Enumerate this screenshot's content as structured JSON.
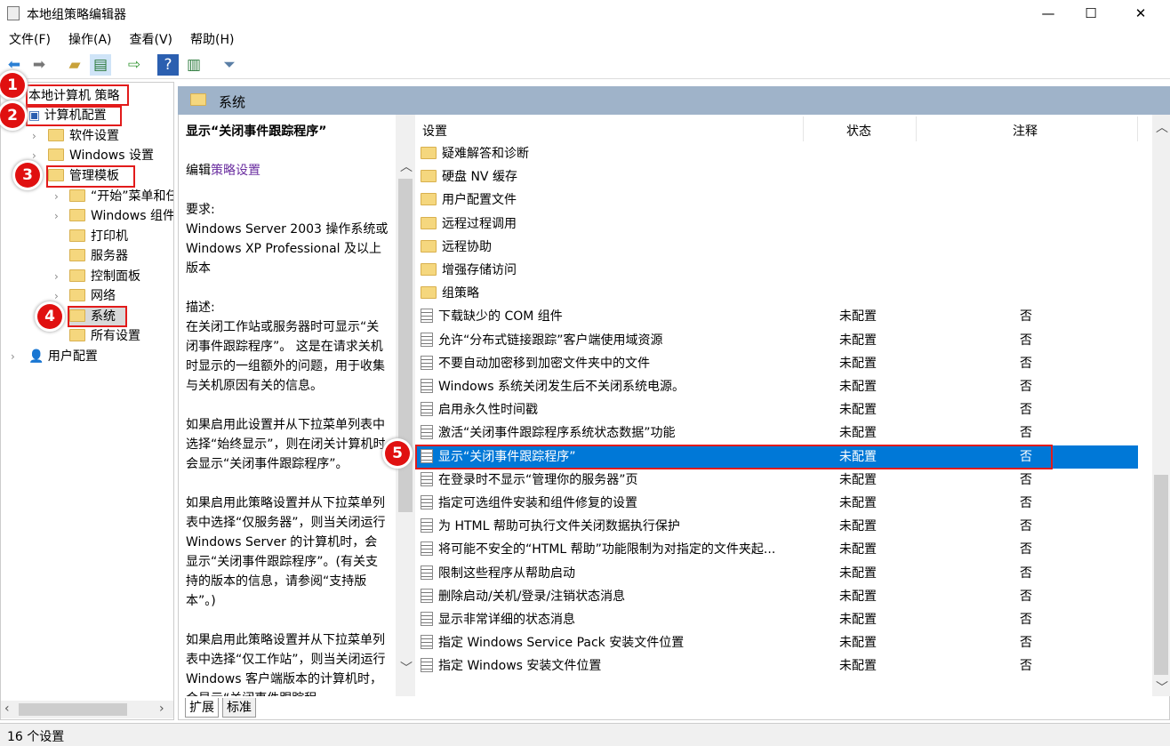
{
  "window": {
    "title": "本地组策略编辑器",
    "min": "—",
    "max": "☐",
    "close": "✕"
  },
  "menu": [
    "文件(F)",
    "操作(A)",
    "查看(V)",
    "帮助(H)"
  ],
  "tree": {
    "root": "本地计算机 策略",
    "computer": "计算机配置",
    "software": "软件设置",
    "windows": "Windows 设置",
    "admin": "管理模板",
    "start": "“开始”菜单和任务栏",
    "wincomp": "Windows 组件",
    "printer": "打印机",
    "server": "服务器",
    "control": "控制面板",
    "network": "网络",
    "system": "系统",
    "all": "所有设置",
    "user": "用户配置"
  },
  "badges": [
    "1",
    "2",
    "3",
    "4",
    "5"
  ],
  "header": {
    "title": "系统"
  },
  "desc": {
    "title": "显示“关闭事件跟踪程序”",
    "edit_prefix": "编辑",
    "edit_link": "策略设置",
    "req_label": "要求:",
    "req": "Windows Server 2003 操作系统或 Windows XP Professional 及以上版本",
    "desc_label": "描述:",
    "p1": "在关闭工作站或服务器时可显示“关闭事件跟踪程序”。 这是在请求关机时显示的一组额外的问题，用于收集与关机原因有关的信息。",
    "p2": "如果启用此设置并从下拉菜单列表中选择“始终显示”，则在闭关计算机时会显示“关闭事件跟踪程序”。",
    "p3": "如果启用此策略设置并从下拉菜单列表中选择“仅服务器”，则当关闭运行 Windows Server 的计算机时，会显示“关闭事件跟踪程序”。(有关支持的版本的信息，请参阅“支持版本”。)",
    "p4": "如果启用此策略设置并从下拉菜单列表中选择“仅工作站”，则当关闭运行 Windows 客户端版本的计算机时，会显示“关闭事件跟踪程"
  },
  "columns": [
    "设置",
    "状态",
    "注释"
  ],
  "folders": [
    "疑难解答和诊断",
    "硬盘 NV 缓存",
    "用户配置文件",
    "远程过程调用",
    "远程协助",
    "增强存储访问",
    "组策略"
  ],
  "settings": [
    {
      "name": "下载缺少的 COM 组件",
      "state": "未配置",
      "note": "否"
    },
    {
      "name": "允许“分布式链接跟踪”客户端使用域资源",
      "state": "未配置",
      "note": "否"
    },
    {
      "name": "不要自动加密移到加密文件夹中的文件",
      "state": "未配置",
      "note": "否"
    },
    {
      "name": "Windows 系统关闭发生后不关闭系统电源。",
      "state": "未配置",
      "note": "否"
    },
    {
      "name": "启用永久性时间戳",
      "state": "未配置",
      "note": "否"
    },
    {
      "name": "激活“关闭事件跟踪程序系统状态数据”功能",
      "state": "未配置",
      "note": "否"
    },
    {
      "name": "显示“关闭事件跟踪程序”",
      "state": "未配置",
      "note": "否",
      "selected": true
    },
    {
      "name": "在登录时不显示“管理你的服务器”页",
      "state": "未配置",
      "note": "否"
    },
    {
      "name": "指定可选组件安装和组件修复的设置",
      "state": "未配置",
      "note": "否"
    },
    {
      "name": "为 HTML 帮助可执行文件关闭数据执行保护",
      "state": "未配置",
      "note": "否"
    },
    {
      "name": "将可能不安全的“HTML 帮助”功能限制为对指定的文件夹起...",
      "state": "未配置",
      "note": "否"
    },
    {
      "name": "限制这些程序从帮助启动",
      "state": "未配置",
      "note": "否"
    },
    {
      "name": "删除启动/关机/登录/注销状态消息",
      "state": "未配置",
      "note": "否"
    },
    {
      "name": "显示非常详细的状态消息",
      "state": "未配置",
      "note": "否"
    },
    {
      "name": "指定 Windows Service Pack 安装文件位置",
      "state": "未配置",
      "note": "否"
    },
    {
      "name": "指定 Windows 安装文件位置",
      "state": "未配置",
      "note": "否"
    }
  ],
  "tabs": [
    "扩展",
    "标准"
  ],
  "status": "16 个设置",
  "colors": {
    "selection": "#0078d7",
    "header": "#9fb3c9",
    "highlight": "#e21b1b"
  }
}
